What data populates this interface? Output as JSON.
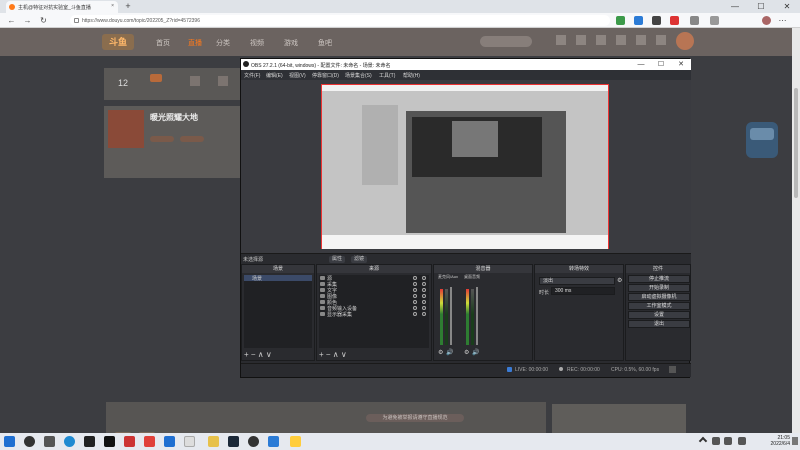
{
  "browser": {
    "tab_title": "主机@特征对抗实验室_斗鱼直播",
    "tab_close": "×",
    "new_tab": "+",
    "url": "https://www.douyu.com/topic/202205_Z?rid=4572396",
    "nav": {
      "back": "←",
      "forward": "→",
      "reload": "↻"
    },
    "win": {
      "min": "—",
      "max": "☐",
      "close": "✕"
    }
  },
  "site": {
    "logo": "斗鱼",
    "nav_items": [
      "首页",
      "直播",
      "分类",
      "视频",
      "游戏",
      "鱼吧"
    ],
    "left_card_count": "12",
    "streamer_name": "暖光照耀大地",
    "notice": "为避免被举报请遵守直播规范",
    "colors": {
      "active_nav": "#ff7a1a",
      "overlay": "#3c3d41"
    }
  },
  "obs": {
    "title": "OBS 27.2.1 (64-bit, windows) - 配置文件: 未命名 - 场景: 未命名",
    "menu": [
      "文件(F)",
      "编辑(E)",
      "视图(V)",
      "停靠窗口(D)",
      "场景集合(S)",
      "工具(T)",
      "帮助(H)"
    ],
    "scene_label": "未选择源",
    "scene_buttons": [
      "属性",
      "滤镜"
    ],
    "docks": {
      "scenes": {
        "title": "场景",
        "items": [
          "场景"
        ]
      },
      "sources": {
        "title": "来源",
        "items": [
          "源",
          "采集",
          "文字",
          "图像",
          "颜色",
          "音频输入设备",
          "显示器采集"
        ]
      },
      "mixer": {
        "title": "混音器",
        "ch1": "桌面音频",
        "ch2": "麦克风/Aux",
        "db1": "0.0 dB",
        "db2": "0.0 dB"
      },
      "transitions": {
        "title": "转场特效",
        "type": "淡出",
        "duration_label": "时长",
        "duration": "300 ms"
      },
      "controls": {
        "title": "控件",
        "buttons": [
          "停止推流",
          "开始录制",
          "启动虚拟摄像机",
          "工作室模式",
          "设置",
          "退出"
        ]
      }
    },
    "foot": "+ − ∧ ∨",
    "status": {
      "live": "LIVE: 00:00:00",
      "rec": "REC: 00:00:00",
      "cpu": "CPU: 0.5%, 60.00 fps"
    }
  },
  "taskbar": {
    "time": "21:05",
    "date": "2022/6/4"
  }
}
